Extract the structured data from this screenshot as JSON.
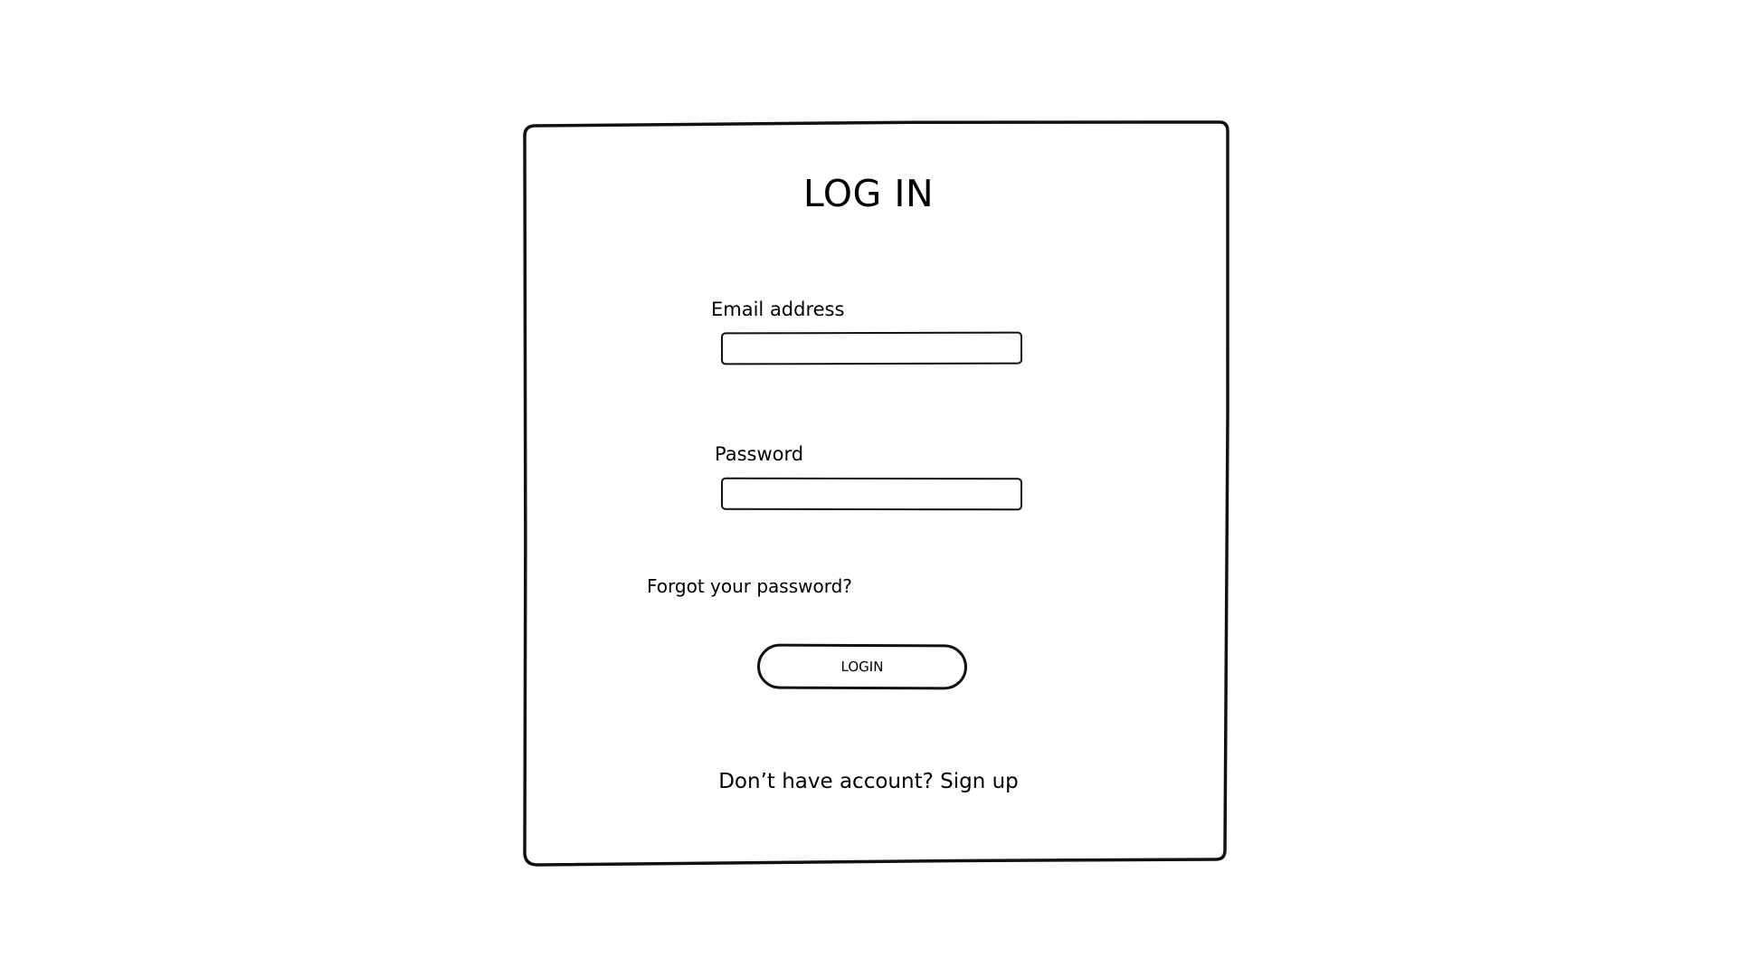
{
  "login_form": {
    "title": "LOG IN",
    "email": {
      "label": "Email address",
      "value": "",
      "placeholder": ""
    },
    "password": {
      "label": "Password",
      "value": "",
      "placeholder": ""
    },
    "forgot_password_link": "Forgot your password?",
    "login_button_label": "LOGIN",
    "signup_prompt": "Don’t have account?",
    "signup_link": "Sign up"
  },
  "colors": {
    "background": "#ffffff",
    "ink": "#111111"
  }
}
